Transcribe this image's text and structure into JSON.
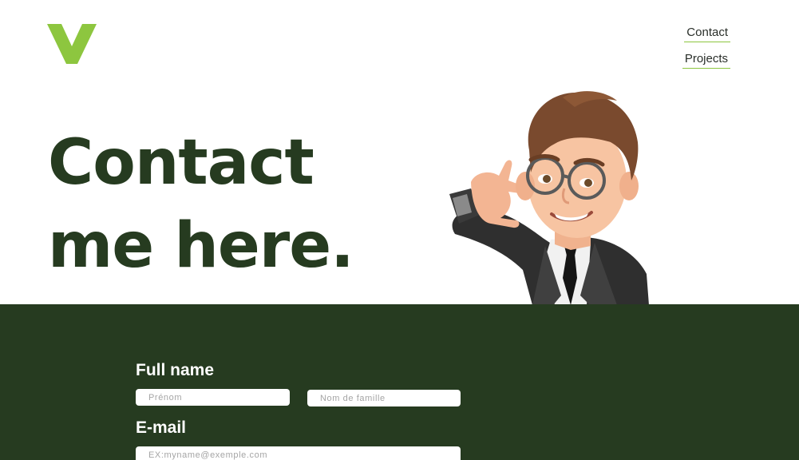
{
  "header": {
    "logo_icon": "v-logo-icon",
    "nav": [
      {
        "label": "Contact"
      },
      {
        "label": "Projects"
      }
    ]
  },
  "hero": {
    "title_line1": "Contact",
    "title_line2": "me here.",
    "avatar_icon": "memoji-call-me-avatar"
  },
  "form": {
    "full_name_label": "Full name",
    "first_name_placeholder": "Prénom",
    "last_name_placeholder": "Nom de famille",
    "email_label": "E-mail",
    "email_placeholder": "EX:myname@exemple.com"
  },
  "colors": {
    "accent": "#8dc63f",
    "dark_green": "#263b20",
    "white": "#ffffff"
  }
}
